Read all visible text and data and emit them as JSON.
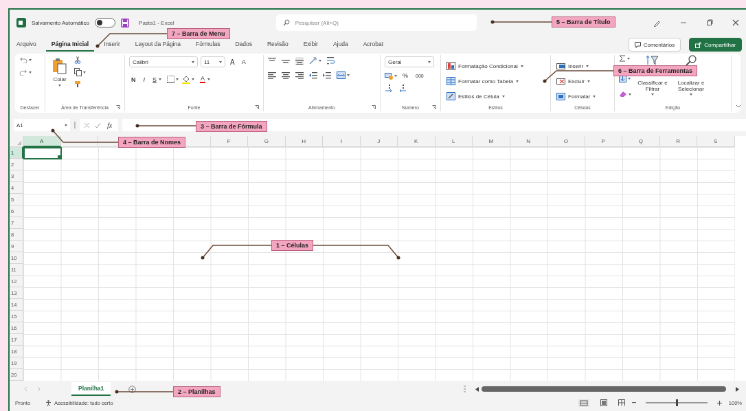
{
  "title_bar": {
    "autosave": {
      "label": "Salvamento Automático",
      "on": false
    },
    "document": "Pasta1 - Excel",
    "search": {
      "placeholder": "Pesquisar (Alt+Q)"
    }
  },
  "menu": {
    "tabs": [
      {
        "label": "Arquivo",
        "selected": false
      },
      {
        "label": "Página Inicial",
        "selected": true
      },
      {
        "label": "Inserir",
        "selected": false
      },
      {
        "label": "Layout da Página",
        "selected": false
      },
      {
        "label": "Fórmulas",
        "selected": false
      },
      {
        "label": "Dados",
        "selected": false
      },
      {
        "label": "Revisão",
        "selected": false
      },
      {
        "label": "Exibir",
        "selected": false
      },
      {
        "label": "Ajuda",
        "selected": false
      },
      {
        "label": "Acrobat",
        "selected": false
      }
    ],
    "buttons": [
      {
        "label": "Comentários",
        "kind": "outline"
      },
      {
        "label": "Compartilhar",
        "kind": "primary"
      }
    ]
  },
  "ribbon": {
    "groups": [
      {
        "kind": "undo",
        "label": "Desfazer"
      },
      {
        "kind": "clipboard",
        "label": "Área de Transferência",
        "paste": "Colar"
      },
      {
        "kind": "font",
        "label": "Fonte",
        "font": "Calibri",
        "size": "11",
        "grow": "A",
        "shrink": "A",
        "bold": "N",
        "italic": "I",
        "underline": "S",
        "font_color": "A"
      },
      {
        "kind": "alignment",
        "label": "Alinhamento"
      },
      {
        "kind": "number",
        "label": "Número",
        "format": "Geral",
        "percent": "%",
        "thousands": "000"
      },
      {
        "kind": "styles",
        "label": "Estilos",
        "items": [
          "Formatação Condicional",
          "Formatar como Tabela",
          "Estilos de Célula"
        ]
      },
      {
        "kind": "cells",
        "label": "Células",
        "items": [
          "Inserir",
          "Excluir",
          "Formatar"
        ]
      },
      {
        "kind": "editing",
        "label": "Edição",
        "items": [
          "Classificar e Filtrar",
          "Localizar e Selecionar"
        ]
      }
    ]
  },
  "formula_bar": {
    "name_box": "A1",
    "function_label": "fx"
  },
  "grid": {
    "columns": [
      {
        "label": "A",
        "selected": true
      },
      {
        "selected": false
      },
      {
        "selected": false
      },
      {
        "selected": false
      },
      {
        "selected": false
      },
      {
        "label": "F",
        "selected": false
      },
      {
        "label": "G",
        "selected": false
      },
      {
        "label": "H",
        "selected": false
      },
      {
        "label": "I",
        "selected": false
      },
      {
        "label": "J",
        "selected": false
      },
      {
        "label": "K",
        "selected": false
      },
      {
        "label": "L",
        "selected": false
      },
      {
        "label": "M",
        "selected": false
      },
      {
        "label": "N",
        "selected": false
      },
      {
        "label": "O",
        "selected": false
      },
      {
        "label": "P",
        "selected": false
      },
      {
        "label": "Q",
        "selected": false
      },
      {
        "label": "R",
        "selected": false
      },
      {
        "label": "S",
        "selected": false
      }
    ],
    "rows": [
      {
        "label": "1",
        "selected": true
      },
      {
        "label": "2",
        "selected": false
      },
      {
        "label": "3",
        "selected": false
      },
      {
        "label": "4",
        "selected": false
      },
      {
        "label": "5",
        "selected": false
      },
      {
        "label": "6",
        "selected": false
      },
      {
        "label": "7",
        "selected": false
      },
      {
        "label": "8",
        "selected": false
      },
      {
        "label": "9",
        "selected": false
      },
      {
        "label": "10",
        "selected": false
      },
      {
        "label": "11",
        "selected": false
      },
      {
        "label": "12",
        "selected": false
      },
      {
        "label": "13",
        "selected": false
      },
      {
        "label": "14",
        "selected": false
      },
      {
        "label": "15",
        "selected": false
      },
      {
        "label": "16",
        "selected": false
      },
      {
        "label": "17",
        "selected": false
      },
      {
        "label": "18",
        "selected": false
      },
      {
        "label": "19",
        "selected": false
      },
      {
        "label": "20",
        "selected": false
      }
    ]
  },
  "sheet_tabs": [
    {
      "label": "Planilha1",
      "selected": true
    }
  ],
  "status_bar": {
    "status": "Pronto",
    "accessibility": "Acessibilidade: tudo certo",
    "zoom": {
      "level": 0.5,
      "reading": "100%"
    }
  },
  "annotations": [
    {
      "label": "1 – Células"
    },
    {
      "label": "2 – Planilhas"
    },
    {
      "label": "3 – Barra de Fórmula"
    },
    {
      "label": "4 – Barra de Nomes"
    },
    {
      "label": "5 – Barra de Título"
    },
    {
      "label": "6 – Barra de Ferramentas"
    },
    {
      "label": "7 – Barra de Menu"
    }
  ]
}
